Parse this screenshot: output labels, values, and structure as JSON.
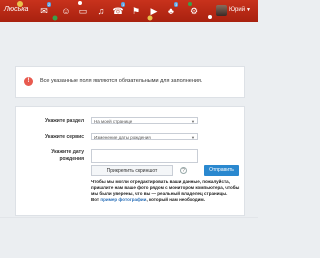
{
  "topbar": {
    "brand": "Люська",
    "icons": [
      {
        "name": "envelope-icon",
        "glyph": "✉",
        "badge": "2"
      },
      {
        "name": "people-icon",
        "glyph": "👥",
        "badge": ""
      },
      {
        "name": "chat-icon",
        "glyph": "▭",
        "badge": ""
      },
      {
        "name": "music-icon",
        "glyph": "♫",
        "badge": ""
      },
      {
        "name": "notifications-icon",
        "glyph": "☎",
        "badge": "1"
      },
      {
        "name": "events-icon",
        "glyph": "⚑",
        "badge": ""
      },
      {
        "name": "video-icon",
        "glyph": "▶",
        "badge": ""
      },
      {
        "name": "games-icon",
        "glyph": "♣",
        "badge": "3"
      },
      {
        "name": "settings-icon",
        "glyph": "⚙",
        "badge": ""
      }
    ],
    "user_name": "Юрий",
    "colors": {
      "bar": "#b8261a",
      "accent_badge": "#5aa0e0"
    }
  },
  "alert": {
    "icon": "!",
    "message": "Все указанные поля являются обязательными для заполнения."
  },
  "form": {
    "section_label": "Укажите раздел",
    "section_value": "На моей странице",
    "service_label": "Укажите сервис",
    "service_value": "Изменение даты рождения",
    "date_label_line1": "Укажите дату",
    "date_label_line2": "рождения",
    "attach_label": "Прикрепить скриншот",
    "help_icon": "?",
    "submit_label": "Отправить",
    "note_text": "Чтобы мы могли отредактировать ваши данные, пожалуйста, пришлите нам ваше фото рядом с монитором компьютера, чтобы мы были уверены, что вы — реальный владелец страницы.",
    "note_prefix": "Вот",
    "note_link": "пример фотографии",
    "note_suffix": ", который нам необходим.",
    "submit_color": "#2a88cf"
  }
}
